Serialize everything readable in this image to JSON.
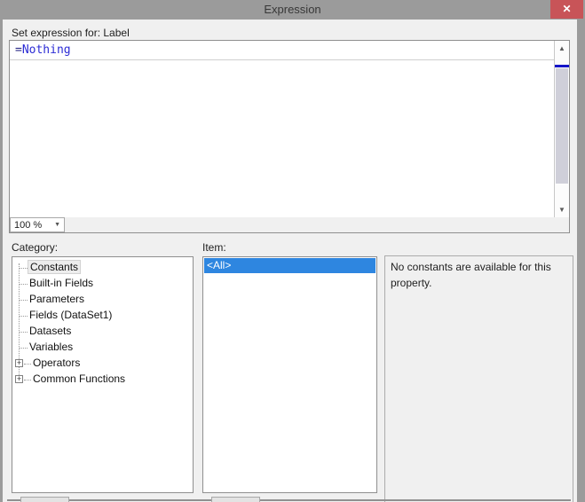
{
  "window": {
    "title": "Expression",
    "close_label": "✕"
  },
  "expression_editor": {
    "set_expression_label": "Set expression for: Label",
    "code_line": {
      "operator": "=",
      "keyword": "Nothing"
    },
    "zoom_control": {
      "value": "100 %"
    }
  },
  "category_section": {
    "label": "Category:",
    "tree": [
      {
        "label": "Constants",
        "expandable": false,
        "selected": true
      },
      {
        "label": "Built-in Fields",
        "expandable": false,
        "selected": false
      },
      {
        "label": "Parameters",
        "expandable": false,
        "selected": false
      },
      {
        "label": "Fields (DataSet1)",
        "expandable": false,
        "selected": false
      },
      {
        "label": "Datasets",
        "expandable": false,
        "selected": false
      },
      {
        "label": "Variables",
        "expandable": false,
        "selected": false
      },
      {
        "label": "Operators",
        "expandable": true,
        "selected": false
      },
      {
        "label": "Common Functions",
        "expandable": true,
        "selected": false
      }
    ]
  },
  "item_section": {
    "label": "Item:",
    "items": [
      {
        "label": "<All>",
        "selected": true
      }
    ]
  },
  "description_panel": {
    "text": "No constants are available for this property."
  },
  "colors": {
    "titlebar": "#9B9B9B",
    "close_button": "#C85458",
    "dialog_background": "#F0F0F0",
    "selection_blue": "#2E86E0",
    "keyword_blue": "#2B2BD5",
    "scrollbar_annotation": "#1414C8"
  }
}
